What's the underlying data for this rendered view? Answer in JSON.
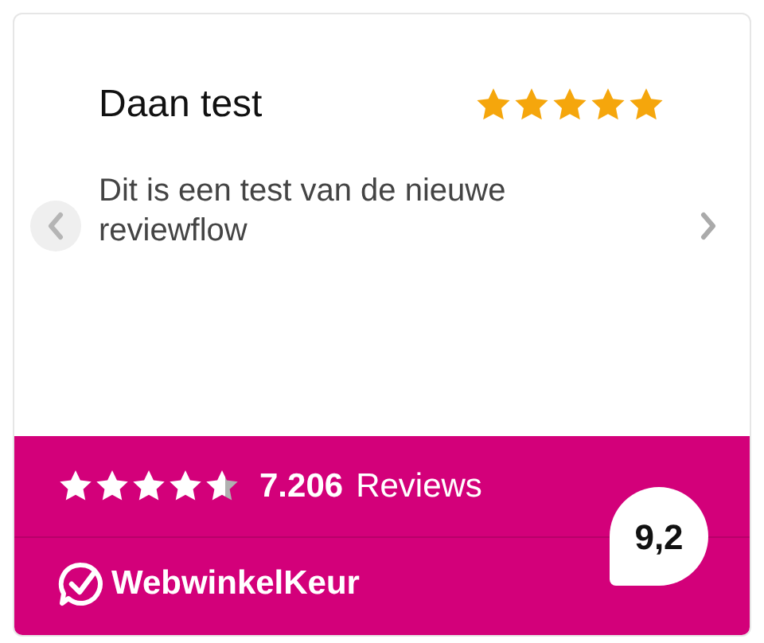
{
  "review": {
    "author": "Daan test",
    "stars": 5,
    "text": "Dit is een test van de nieuwe reviewflow"
  },
  "carousel": {
    "prev_disabled": true,
    "next_disabled": false
  },
  "summary": {
    "stars": 4.6,
    "count": "7.206",
    "count_label": "Reviews",
    "brand": "WebwinkelKeur",
    "score": "9,2"
  }
}
